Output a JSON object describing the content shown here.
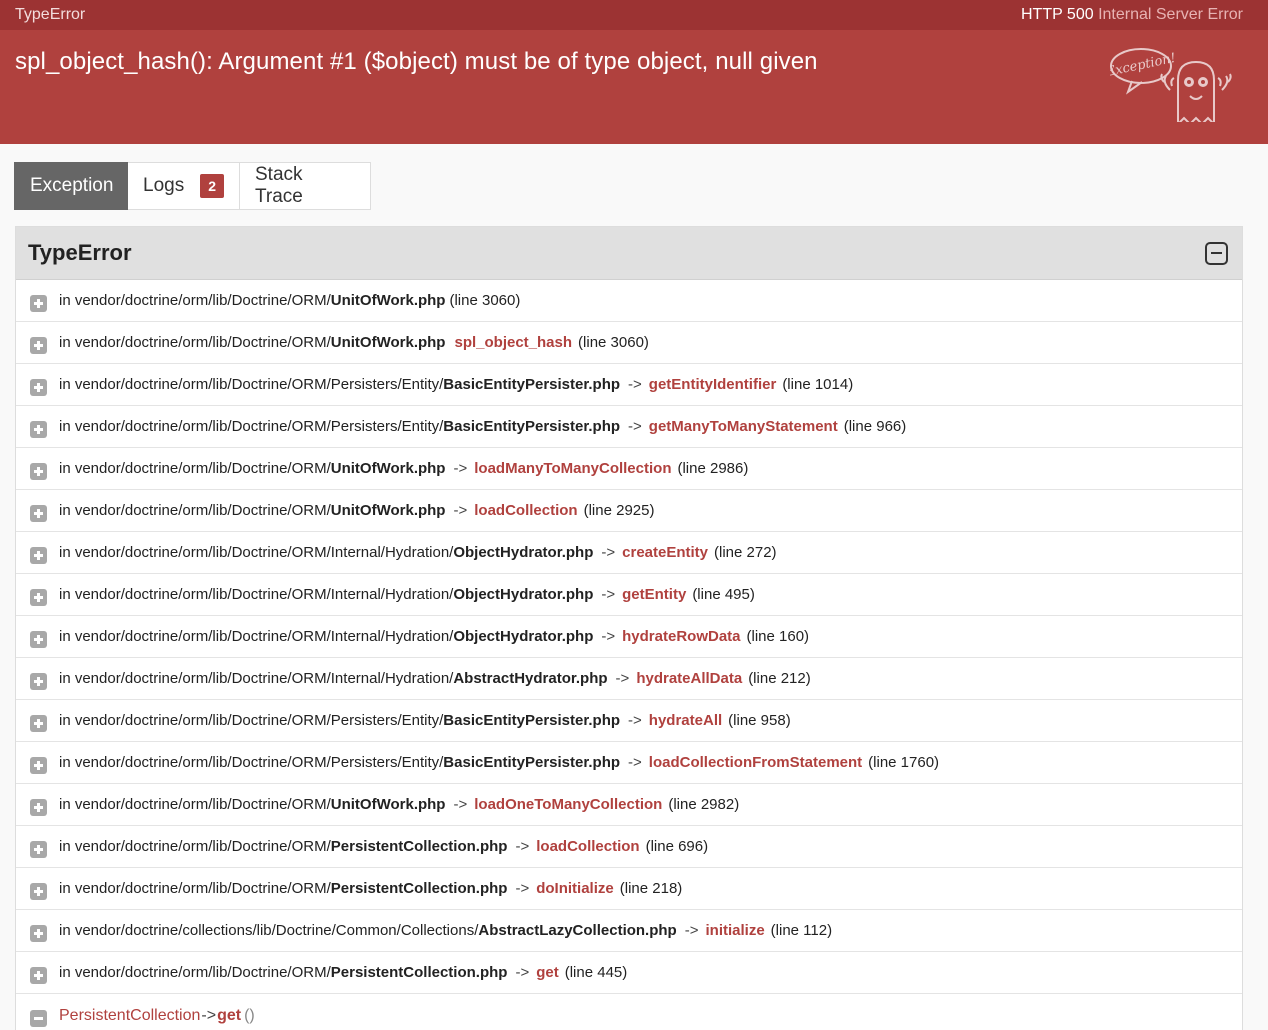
{
  "topbar": {
    "error_class": "TypeError",
    "status_code": "HTTP 500",
    "status_text": "Internal Server Error"
  },
  "header": {
    "message": "spl_object_hash(): Argument #1 ($object) must be of type object, null given",
    "ghost_bubble": "Exception!"
  },
  "tabs": [
    {
      "label": "Exception",
      "active": true
    },
    {
      "label": "Logs",
      "badge": "2"
    },
    {
      "label": "Stack Trace"
    }
  ],
  "panel": {
    "title": "TypeError",
    "trace": [
      {
        "path": "in vendor/doctrine/orm/lib/Doctrine/ORM/",
        "file": "UnitOfWork.php",
        "arrow": "",
        "fn": "",
        "line": "(line 3060)"
      },
      {
        "path": "in vendor/doctrine/orm/lib/Doctrine/ORM/",
        "file": "UnitOfWork.php",
        "arrow": "",
        "fn": "spl_object_hash",
        "line": "(line 3060)"
      },
      {
        "path": "in vendor/doctrine/orm/lib/Doctrine/ORM/Persisters/Entity/",
        "file": "BasicEntityPersister.php",
        "arrow": "->",
        "fn": "getEntityIdentifier",
        "line": "(line 1014)"
      },
      {
        "path": "in vendor/doctrine/orm/lib/Doctrine/ORM/Persisters/Entity/",
        "file": "BasicEntityPersister.php",
        "arrow": "->",
        "fn": "getManyToManyStatement",
        "line": "(line 966)"
      },
      {
        "path": "in vendor/doctrine/orm/lib/Doctrine/ORM/",
        "file": "UnitOfWork.php",
        "arrow": "->",
        "fn": "loadManyToManyCollection",
        "line": "(line 2986)"
      },
      {
        "path": "in vendor/doctrine/orm/lib/Doctrine/ORM/",
        "file": "UnitOfWork.php",
        "arrow": "->",
        "fn": "loadCollection",
        "line": "(line 2925)"
      },
      {
        "path": "in vendor/doctrine/orm/lib/Doctrine/ORM/Internal/Hydration/",
        "file": "ObjectHydrator.php",
        "arrow": "->",
        "fn": "createEntity",
        "line": "(line 272)"
      },
      {
        "path": "in vendor/doctrine/orm/lib/Doctrine/ORM/Internal/Hydration/",
        "file": "ObjectHydrator.php",
        "arrow": "->",
        "fn": "getEntity",
        "line": "(line 495)"
      },
      {
        "path": "in vendor/doctrine/orm/lib/Doctrine/ORM/Internal/Hydration/",
        "file": "ObjectHydrator.php",
        "arrow": "->",
        "fn": "hydrateRowData",
        "line": "(line 160)"
      },
      {
        "path": "in vendor/doctrine/orm/lib/Doctrine/ORM/Internal/Hydration/",
        "file": "AbstractHydrator.php",
        "arrow": "->",
        "fn": "hydrateAllData",
        "line": "(line 212)"
      },
      {
        "path": "in vendor/doctrine/orm/lib/Doctrine/ORM/Persisters/Entity/",
        "file": "BasicEntityPersister.php",
        "arrow": "->",
        "fn": "hydrateAll",
        "line": "(line 958)"
      },
      {
        "path": "in vendor/doctrine/orm/lib/Doctrine/ORM/Persisters/Entity/",
        "file": "BasicEntityPersister.php",
        "arrow": "->",
        "fn": "loadCollectionFromStatement",
        "line": "(line 1760)"
      },
      {
        "path": "in vendor/doctrine/orm/lib/Doctrine/ORM/",
        "file": "UnitOfWork.php",
        "arrow": "->",
        "fn": "loadOneToManyCollection",
        "line": "(line 2982)"
      },
      {
        "path": "in vendor/doctrine/orm/lib/Doctrine/ORM/",
        "file": "PersistentCollection.php",
        "arrow": "->",
        "fn": "loadCollection",
        "line": "(line 696)"
      },
      {
        "path": "in vendor/doctrine/orm/lib/Doctrine/ORM/",
        "file": "PersistentCollection.php",
        "arrow": "->",
        "fn": "doInitialize",
        "line": "(line 218)"
      },
      {
        "path": "in vendor/doctrine/collections/lib/Doctrine/Common/Collections/",
        "file": "AbstractLazyCollection.php",
        "arrow": "->",
        "fn": "initialize",
        "line": "(line 112)"
      },
      {
        "path": "in vendor/doctrine/orm/lib/Doctrine/ORM/",
        "file": "PersistentCollection.php",
        "arrow": "->",
        "fn": "get",
        "line": "(line 445)"
      }
    ],
    "expanded": {
      "class": "PersistentCollection",
      "arrow": "->",
      "fn": "get",
      "args": "()"
    }
  },
  "colors": {
    "topbar": "#9c3333",
    "header": "#b0413e",
    "accent": "#b0413e"
  }
}
